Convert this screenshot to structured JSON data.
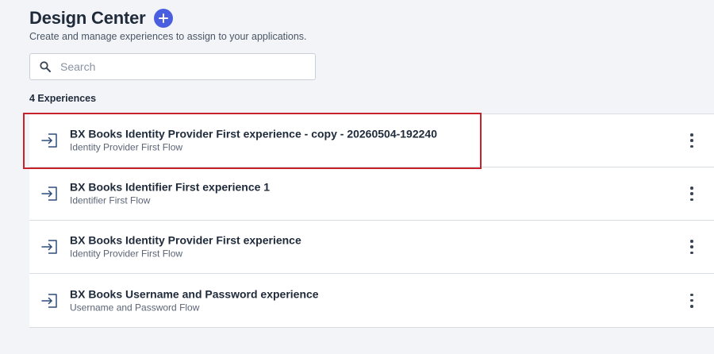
{
  "header": {
    "title": "Design Center",
    "subtitle": "Create and manage experiences to assign to your applications."
  },
  "search": {
    "placeholder": "Search",
    "value": ""
  },
  "count_label": "4 Experiences",
  "experiences": [
    {
      "title": "BX Books Identity Provider First experience - copy - 20260504-192240",
      "subtitle": "Identity Provider First Flow",
      "icon": "sign-in-icon",
      "highlighted": true
    },
    {
      "title": "BX Books Identifier First experience 1",
      "subtitle": "Identifier First Flow",
      "icon": "sign-in-icon",
      "highlighted": false
    },
    {
      "title": "BX Books Identity Provider First experience",
      "subtitle": "Identity Provider First Flow",
      "icon": "sign-in-icon",
      "highlighted": false
    },
    {
      "title": "BX Books Username and Password experience",
      "subtitle": "Username and Password Flow",
      "icon": "sign-in-icon",
      "highlighted": false
    }
  ],
  "colors": {
    "accent": "#4a5fe0",
    "highlight_border": "#c8222b",
    "icon": "#2f4b7c"
  }
}
